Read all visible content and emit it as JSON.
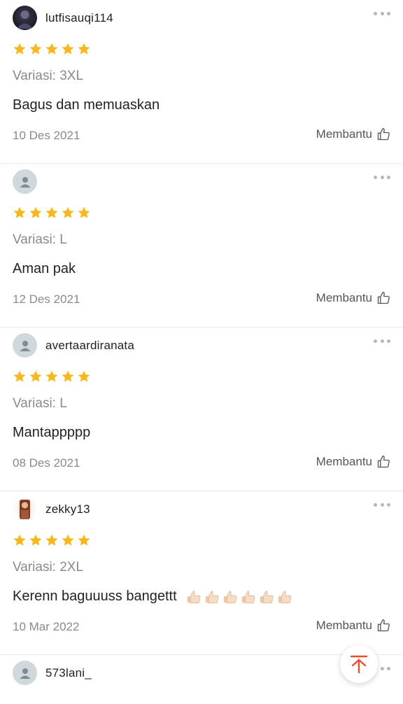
{
  "reviews": [
    {
      "username": "lutfisauqi114",
      "avatar": "user-photo",
      "rating": 5,
      "variant": "Variasi: 3XL",
      "text": "Bagus dan memuaskan",
      "date": "10 Des 2021",
      "helpful_label": "Membantu"
    },
    {
      "username": "",
      "avatar": "default-user-icon",
      "rating": 5,
      "variant": "Variasi: L",
      "text": "Aman pak",
      "date": "12 Des 2021",
      "helpful_label": "Membantu"
    },
    {
      "username": "avertaardiranata",
      "avatar": "default-user-icon",
      "rating": 5,
      "variant": "Variasi: L",
      "text": "Mantappppp",
      "date": "08 Des 2021",
      "helpful_label": "Membantu"
    },
    {
      "username": "zekky13",
      "avatar": "user-photo",
      "rating": 5,
      "variant": "Variasi: 2XL",
      "text": "Kerenn baguuuss bangettt",
      "emoji_count": 6,
      "emoji": "thumbs-up-emoji",
      "date": "10 Mar 2022",
      "helpful_label": "Membantu"
    },
    {
      "username": "573lani_",
      "avatar": "default-user-icon"
    }
  ],
  "icons": {
    "more": "more-options-icon",
    "helpful": "thumbs-up-outline-icon",
    "star": "star-icon",
    "scroll_top": "arrow-up-to-top-icon"
  },
  "colors": {
    "star": "#f6b81c",
    "accent": "#ee4d2d",
    "muted_text": "#8a8a8a"
  }
}
